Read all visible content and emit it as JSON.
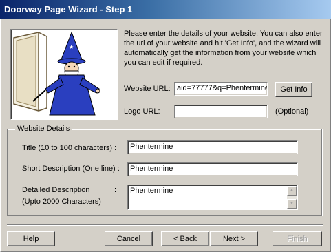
{
  "window": {
    "title": "Doorway Page Wizard - Step 1"
  },
  "intro_text": "Please enter the details of your website. You can also enter the url of your website and hit 'Get Info', and the wizard will automatically get the information from your website which you can edit if required.",
  "website_url": {
    "label": "Website URL:",
    "value": "aid=77777&q=Phentermine",
    "button": "Get Info"
  },
  "logo_url": {
    "label": "Logo URL:",
    "value": "",
    "hint": "(Optional)"
  },
  "details": {
    "legend": "Website Details",
    "title_label": "Title (10 to 100 characters) :",
    "title_value": "Phentermine",
    "short_label": "Short Description (One line) :",
    "short_value": "Phentermine",
    "detailed_label_1": "Detailed Description",
    "detailed_colon": ":",
    "detailed_label_2": "(Upto 2000 Characters)",
    "detailed_value": "Phentermine"
  },
  "buttons": {
    "help": "Help",
    "cancel": "Cancel",
    "back": "< Back",
    "next": "Next >",
    "finish": "Finish"
  },
  "icons": {
    "scroll_up": "scroll-up-arrow-icon",
    "scroll_down": "scroll-down-arrow-icon"
  }
}
